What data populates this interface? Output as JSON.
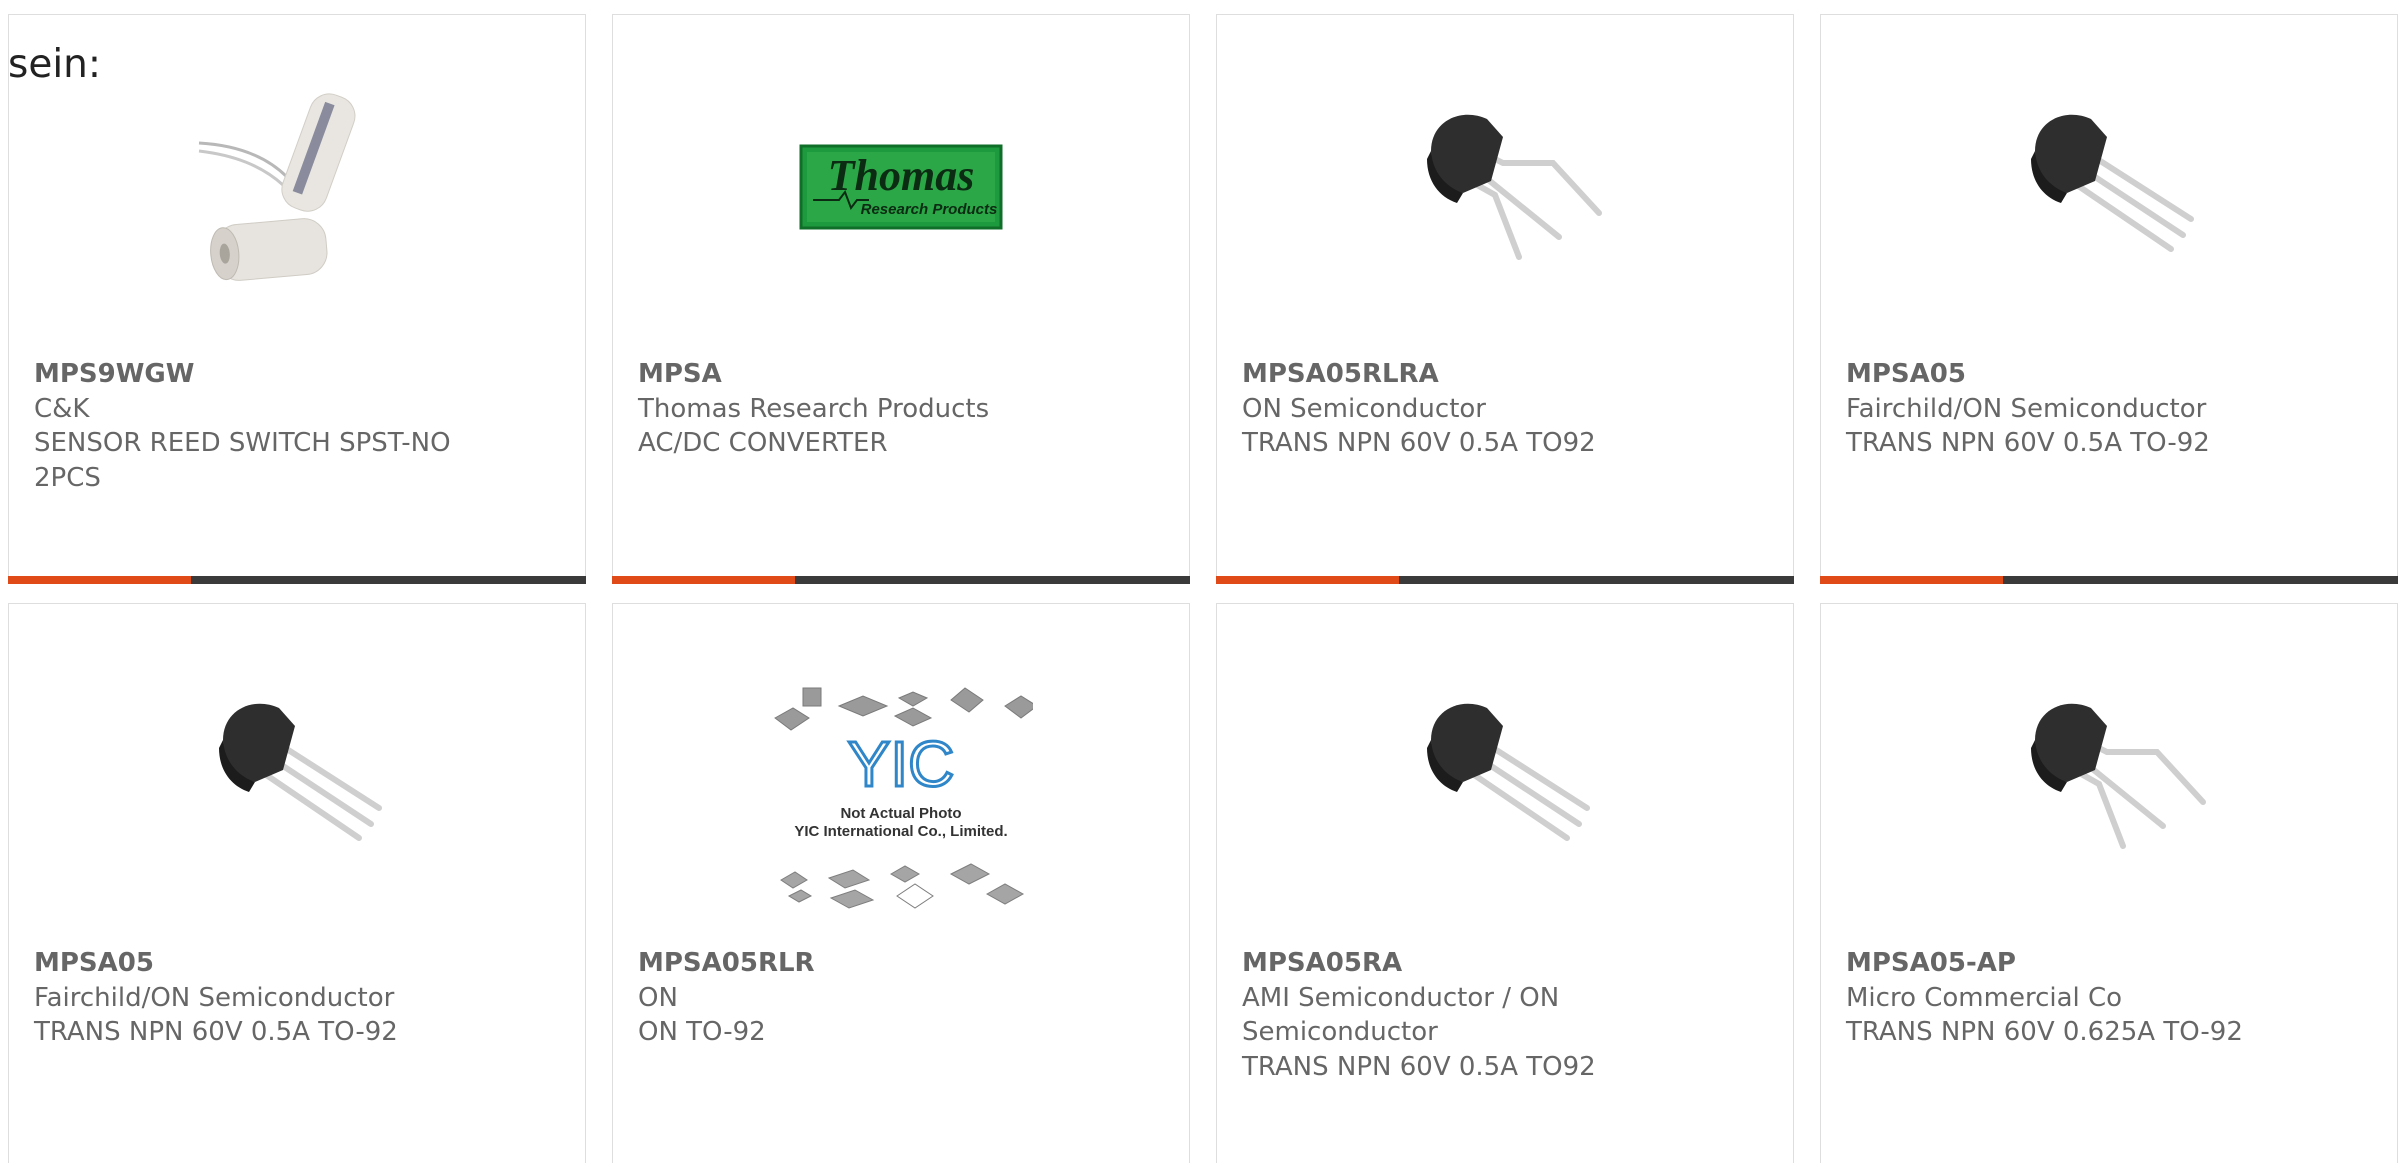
{
  "intro_text": "sein:",
  "colors": {
    "accent": "#e04a18",
    "bar": "#3a3a3a",
    "border": "#dedede",
    "text": "#666666"
  },
  "products": [
    {
      "part_number": "MPS9WGW",
      "manufacturer": "C&K",
      "description": "SENSOR REED SWITCH SPST-NO 2PCS",
      "image": "reed-switch-image",
      "has_bar": true
    },
    {
      "part_number": "MPSA",
      "manufacturer": "Thomas Research Products",
      "description": "AC/DC CONVERTER",
      "image": "thomas-logo-image",
      "logo_text": "Thomas",
      "logo_subtext": "Research Products",
      "has_bar": true
    },
    {
      "part_number": "MPSA05RLRA",
      "manufacturer": "ON Semiconductor",
      "description": "TRANS NPN 60V 0.5A TO92",
      "image": "to92-transistor-image",
      "has_bar": true
    },
    {
      "part_number": "MPSA05",
      "manufacturer": "Fairchild/ON Semiconductor",
      "description": "TRANS NPN 60V 0.5A TO-92",
      "image": "to92-transistor-image",
      "has_bar": true
    },
    {
      "part_number": "MPSA05",
      "manufacturer": "Fairchild/ON Semiconductor",
      "description": "TRANS NPN 60V 0.5A TO-92",
      "image": "to92-transistor-image",
      "has_bar": false
    },
    {
      "part_number": "MPSA05RLR",
      "manufacturer": "ON",
      "description": "ON TO-92",
      "image": "yic-placeholder-image",
      "logo_text": "YIC",
      "caption_1": "Not Actual Photo",
      "caption_2": "YIC International Co., Limited.",
      "has_bar": false
    },
    {
      "part_number": "MPSA05RA",
      "manufacturer": "AMI Semiconductor / ON Semiconductor",
      "description": "TRANS NPN 60V 0.5A TO92",
      "image": "to92-transistor-image",
      "has_bar": false
    },
    {
      "part_number": "MPSA05-AP",
      "manufacturer": "Micro Commercial Co",
      "description": "TRANS NPN 60V 0.625A TO-92",
      "image": "to92-transistor-image",
      "has_bar": false
    }
  ]
}
